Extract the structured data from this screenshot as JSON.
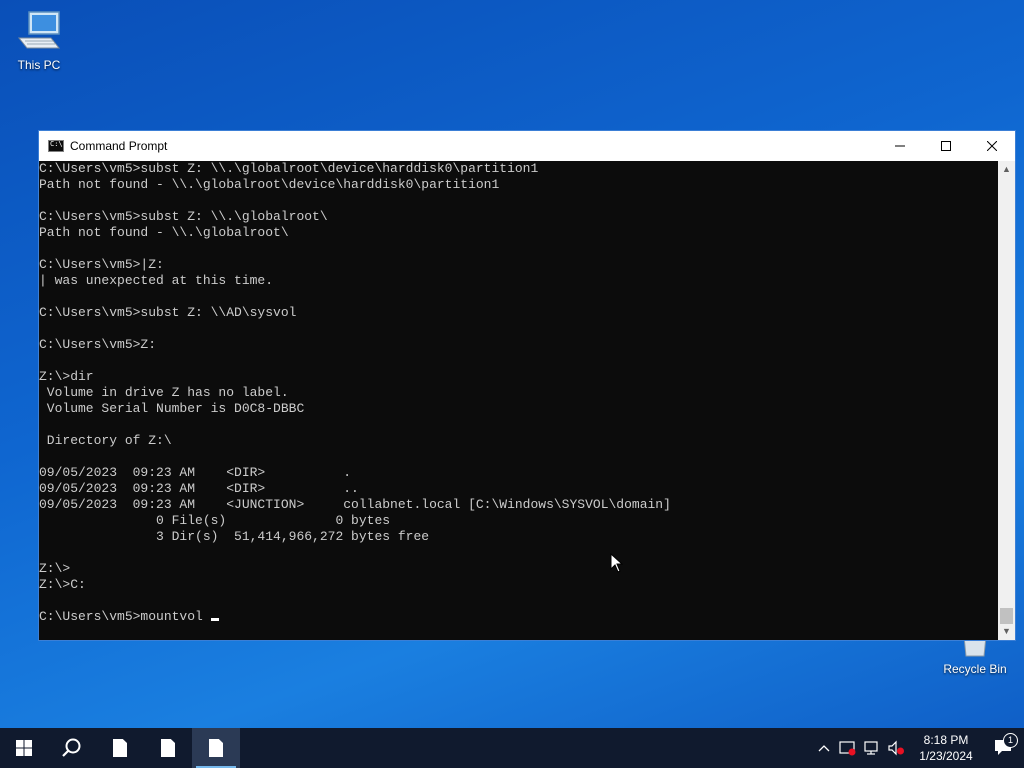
{
  "desktop": {
    "icons": [
      {
        "label": "This PC"
      },
      {
        "label": "Recycle Bin"
      }
    ]
  },
  "window": {
    "title": "Command Prompt",
    "controls": {
      "minimize": "—",
      "maximize": "☐",
      "close": "✕"
    }
  },
  "terminal": {
    "lines": [
      "C:\\Users\\vm5>subst Z: \\\\.\\globalroot\\device\\harddisk0\\partition1",
      "Path not found - \\\\.\\globalroot\\device\\harddisk0\\partition1",
      "",
      "C:\\Users\\vm5>subst Z: \\\\.\\globalroot\\",
      "Path not found - \\\\.\\globalroot\\",
      "",
      "C:\\Users\\vm5>|Z:",
      "| was unexpected at this time.",
      "",
      "C:\\Users\\vm5>subst Z: \\\\AD\\sysvol",
      "",
      "C:\\Users\\vm5>Z:",
      "",
      "Z:\\>dir",
      " Volume in drive Z has no label.",
      " Volume Serial Number is D0C8-DBBC",
      "",
      " Directory of Z:\\",
      "",
      "09/05/2023  09:23 AM    <DIR>          .",
      "09/05/2023  09:23 AM    <DIR>          ..",
      "09/05/2023  09:23 AM    <JUNCTION>     collabnet.local [C:\\Windows\\SYSVOL\\domain]",
      "               0 File(s)              0 bytes",
      "               3 Dir(s)  51,414,966,272 bytes free",
      "",
      "Z:\\>",
      "Z:\\>C:",
      ""
    ],
    "prompt": "C:\\Users\\vm5>mountvol "
  },
  "scrollbar": {
    "up": "▲",
    "down": "▼"
  },
  "taskbar": {
    "clock_time": "8:18 PM",
    "clock_date": "1/23/2024",
    "notification_count": "1"
  },
  "colors": {
    "desktop": "#0f66d0",
    "taskbar": "#101a2e",
    "terminal_bg": "#0c0c0c",
    "terminal_fg": "#cccccc"
  }
}
